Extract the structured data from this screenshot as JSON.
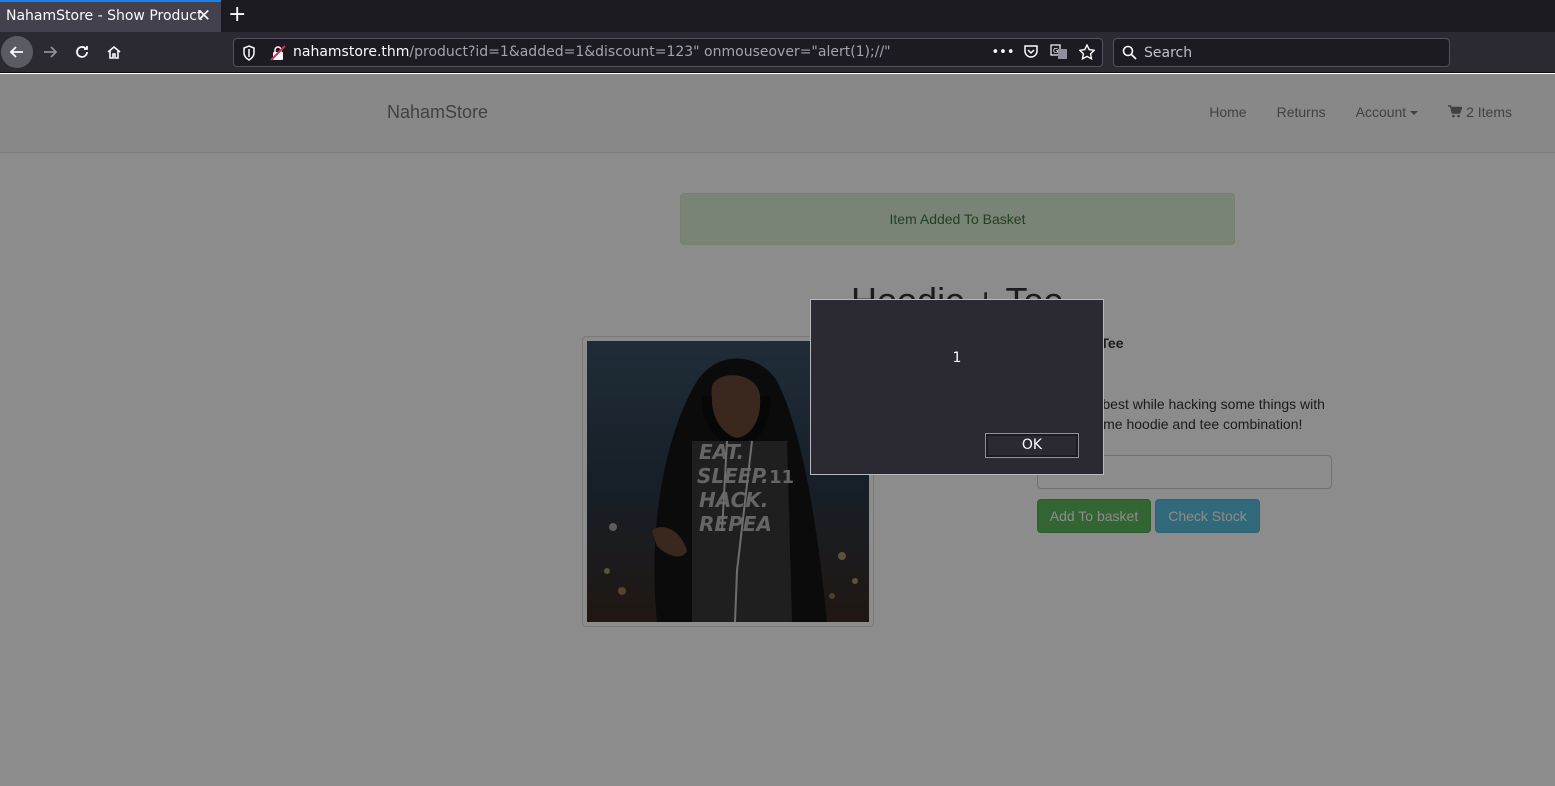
{
  "browser": {
    "tab_title": "NahamStore - Show Product",
    "url_host": "nahamstore.thm",
    "url_path": "/product?id=1&added=1&discount=123\" onmouseover=\"alert(1);//\"",
    "search_placeholder": "Search",
    "accent_color": "#0a84ff"
  },
  "site": {
    "brand": "NahamStore",
    "nav": {
      "home": "Home",
      "returns": "Returns",
      "account": "Account",
      "basket": "2 Items"
    }
  },
  "main": {
    "alert_text": "Item Added To Basket",
    "product_title": "Hoodie + Tee",
    "product_name": "Hoodie + Tee",
    "product_description": "Look your best while hacking some things with this awesome hoodie and tee combination!",
    "add_button": "Add To basket",
    "stock_button": "Check Stock",
    "image_text": [
      "EAT.",
      "SLEEP.",
      "HACK.",
      "REPEA"
    ],
    "image_number": "11"
  },
  "dialog": {
    "message": "1",
    "ok_label": "OK"
  }
}
